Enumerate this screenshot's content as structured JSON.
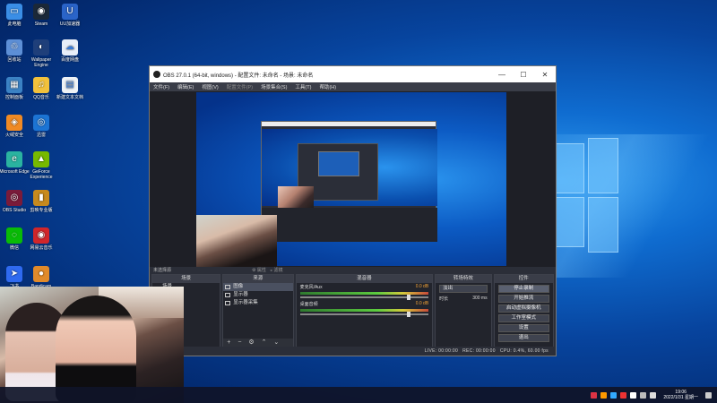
{
  "desktop": {
    "icons": [
      {
        "label": "此电脑",
        "color": "#3a8ee6",
        "glyph": "▭"
      },
      {
        "label": "Steam",
        "color": "#1b2838",
        "glyph": "◉"
      },
      {
        "label": "UU加速器",
        "color": "#2a64c8",
        "glyph": "U"
      },
      {
        "label": "回收站",
        "color": "#5d8fd6",
        "glyph": "♲"
      },
      {
        "label": "Wallpaper Engine",
        "color": "#1f3f7a",
        "glyph": "◐"
      },
      {
        "label": "百度网盘",
        "color": "#e8eef8",
        "glyph": "☁"
      },
      {
        "label": "控制面板",
        "color": "#3b82c4",
        "glyph": "▦"
      },
      {
        "label": "QQ音乐",
        "color": "#f2c13c",
        "glyph": "♫"
      },
      {
        "label": "新建文本文档",
        "color": "#eef2f6",
        "glyph": "▤"
      },
      {
        "label": "火绒安全",
        "color": "#f08a24",
        "glyph": "◈"
      },
      {
        "label": "迅雷",
        "color": "#1c74d4",
        "glyph": "◎"
      },
      {
        "label": "Microsoft Edge",
        "color": "#2ab3a0",
        "glyph": "e"
      },
      {
        "label": "GeForce Experience",
        "color": "#76b900",
        "glyph": "▲"
      },
      {
        "label": "OBS Studio",
        "color": "#7a1b3a",
        "glyph": "◎"
      },
      {
        "label": "剪映专业版",
        "color": "#c78a1e",
        "glyph": "▮"
      },
      {
        "label": "微信",
        "color": "#09bb07",
        "glyph": "◌"
      },
      {
        "label": "网易云音乐",
        "color": "#d1262a",
        "glyph": "◉"
      },
      {
        "label": "飞书",
        "color": "#2f6af0",
        "glyph": "➤"
      },
      {
        "label": "Bandicam",
        "color": "#e18a2a",
        "glyph": "●"
      }
    ]
  },
  "obs": {
    "title": "OBS 27.0.1 (64-bit, windows) - 配置文件: 未命名 - 场景: 未命名",
    "menu": [
      "文件(F)",
      "编辑(E)",
      "视图(V)",
      "配置文件(P)",
      "场景集合(S)",
      "工具(T)",
      "帮助(H)"
    ],
    "no_source": "未选择源",
    "props_label": "属性",
    "filters_label": "滤镜",
    "panels": {
      "scenes": {
        "header": "场景",
        "items": [
          "场景"
        ]
      },
      "sources": {
        "header": "来源",
        "items": [
          "图像",
          "显示器",
          "显示器采集"
        ]
      },
      "mixer": {
        "header": "混音器",
        "channels": [
          {
            "name": "麦克风/Aux",
            "db": "0.0 dB"
          },
          {
            "name": "桌面音频",
            "db": "0.0 dB"
          }
        ]
      },
      "transitions": {
        "header": "转场特效",
        "effect": "淡出",
        "duration_label": "时长",
        "duration": "300 ms"
      },
      "controls": {
        "header": "控件",
        "buttons": [
          "停止录制",
          "开始推流",
          "启动虚拟摄像机",
          "工作室模式",
          "设置",
          "退出"
        ]
      }
    },
    "status": {
      "live": "LIVE: 00:00:00",
      "rec": "REC: 00:00:00",
      "cpu": "CPU: 0.4%, 60.00 fps"
    }
  },
  "taskbar": {
    "time": "19:06",
    "date": "2022/1/31 星期一"
  }
}
